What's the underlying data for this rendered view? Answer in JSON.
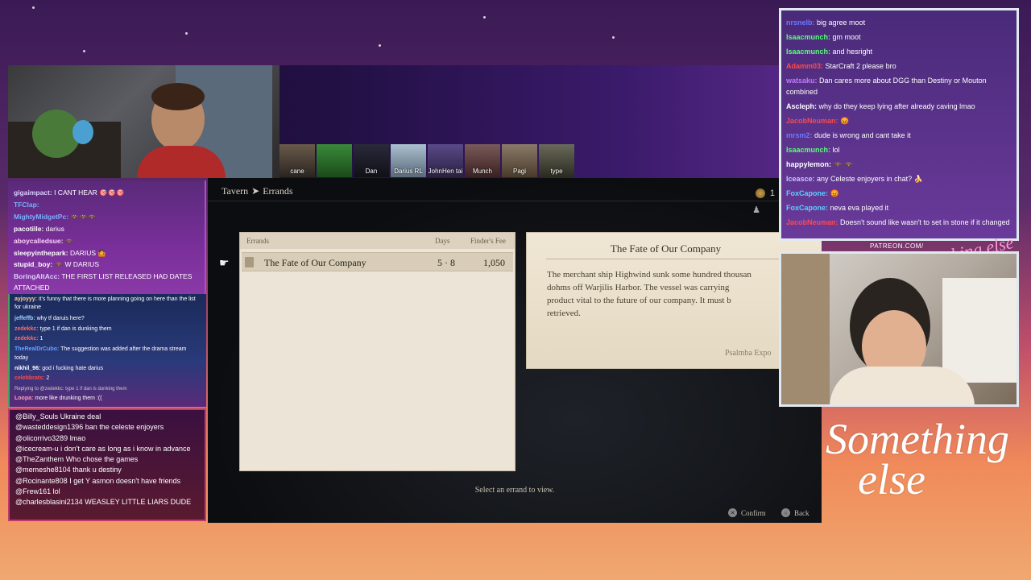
{
  "game": {
    "breadcrumb": [
      "Tavern",
      "Errands"
    ],
    "breadcrumb_sep": "➤",
    "coin_count": "1",
    "table_headers": {
      "name": "Errands",
      "days": "Days",
      "fee": "Finder's Fee"
    },
    "errand": {
      "title": "The Fate of Our Company",
      "days": "5 · 8",
      "fee": "1,050"
    },
    "detail_title": "The Fate of Our Company",
    "detail_lines": [
      "The merchant ship Highwind sunk some hundred thousan",
      "dohms off Warjilis Harbor. The vessel was carrying",
      "product vital to the future of our company. It must b",
      "retrieved."
    ],
    "detail_signature": "Psalmba Expo",
    "hint": "Select an errand to view.",
    "confirm": "Confirm",
    "back": "Back"
  },
  "participants": [
    "cane",
    "",
    "Dan",
    "Darius RL",
    "JohnHen tai",
    "Munch",
    "Pagi",
    "type"
  ],
  "chat_top": [
    {
      "user": "gigaimpact:",
      "text": "I CANT HEAR 🎯🎯🎯"
    },
    {
      "user": "TFClap:",
      "text": ""
    },
    {
      "user": "MightyMidgetPc:",
      "text": "🦇🦇🦇"
    },
    {
      "user": "pacotille:",
      "text": "darius"
    },
    {
      "user": "aboycalledsue:",
      "text": "🦇"
    },
    {
      "user": "sleepyinthepark:",
      "text": "DARIUS 🤷"
    },
    {
      "user": "stupid_boy:",
      "text": "🦇 W DARIUS"
    },
    {
      "user": "BoringAltAcc:",
      "text": "THE FIRST LIST RELEASED HAD DATES ATTACHED"
    }
  ],
  "chat_mid": [
    {
      "user": "ayjoyyy:",
      "text": "it's funny that there is more planning going on here than the list for ukraine"
    },
    {
      "user": "jeffeffb:",
      "text": "why tf daruis here?"
    },
    {
      "user": "zedekkc:",
      "text": "type 1 if dan is dunking them"
    },
    {
      "user": "zedekkc:",
      "text": "1"
    },
    {
      "user": "TheRealDrCubo:",
      "text": "The suggestion was added after the drama stream today"
    },
    {
      "user": "nikhil_96:",
      "text": "god i fucking hate darius"
    },
    {
      "user": "celebbrats:",
      "text": "2"
    },
    {
      "user": "",
      "text": "Replying to @zedekkc: type 1 if dan is dunking them"
    },
    {
      "user": "Loopa:",
      "text": "more like drunking them :(("
    }
  ],
  "chat_bot": [
    {
      "user": "@Billy_Souls",
      "text": "Ukraine deal"
    },
    {
      "user": "@wasteddesign1396",
      "text": "ban the celeste enjoyers"
    },
    {
      "user": "@olicorrivo3289",
      "text": "lmao"
    },
    {
      "user": "@icecream-u",
      "text": "i don't care as long as i know in advance"
    },
    {
      "user": "@TheZanthem",
      "text": "Who chose the games"
    },
    {
      "user": "@memeshe8104",
      "text": "thank u destiny"
    },
    {
      "user": "@Rocinante808",
      "text": "I get Y asmon doesn't have friends"
    },
    {
      "user": "@Frew161",
      "text": "lol"
    },
    {
      "user": "@charlesblasini2134",
      "text": "WEASLEY LITTLE LIARS DUDE"
    }
  ],
  "chat_right": [
    {
      "user": "nrsnelb:",
      "text": "big agree moot",
      "color": "#6a7aff"
    },
    {
      "user": "Isaacmunch:",
      "text": "gm moot",
      "color": "#5aff7a"
    },
    {
      "user": "Isaacmunch:",
      "text": "and hesright",
      "color": "#5aff7a"
    },
    {
      "user": "Adamm03:",
      "text": "StarCraft 2 please bro",
      "color": "#ff4a4a"
    },
    {
      "user": "watsaku:",
      "text": "Dan cares more about DGG than Destiny or Mouton combined",
      "color": "#c07aff"
    },
    {
      "user": "Ascleph:",
      "text": "why do they keep lying after already caving lmao",
      "color": "#ffffff"
    },
    {
      "user": "JacobNeuman:",
      "text": "😡",
      "color": "#ff4a4a"
    },
    {
      "user": "mrsm2:",
      "text": "dude is wrong and cant take it",
      "color": "#6a7aff"
    },
    {
      "user": "Isaacmunch:",
      "text": "lol",
      "color": "#5aff7a"
    },
    {
      "user": "happylemon:",
      "text": "🦇 🦇",
      "color": "#ffffff"
    },
    {
      "user": "Iceasce:",
      "text": "any Celeste enjoyers in chat? 🍌",
      "color": "#c8c8ff"
    },
    {
      "user": "FoxCapone:",
      "text": "😡",
      "color": "#5ad0ff"
    },
    {
      "user": "FoxCapone:",
      "text": "neva eva played it",
      "color": "#5ad0ff"
    },
    {
      "user": "JacobNeuman:",
      "text": "Doesn't sound like wasn't to set in stone if it changed",
      "color": "#ff4a4a"
    }
  ],
  "overlay": {
    "patreon": "PATREON.COM/",
    "logo_small": "Anything else",
    "logo_line1": "Something",
    "logo_line2": "else"
  }
}
